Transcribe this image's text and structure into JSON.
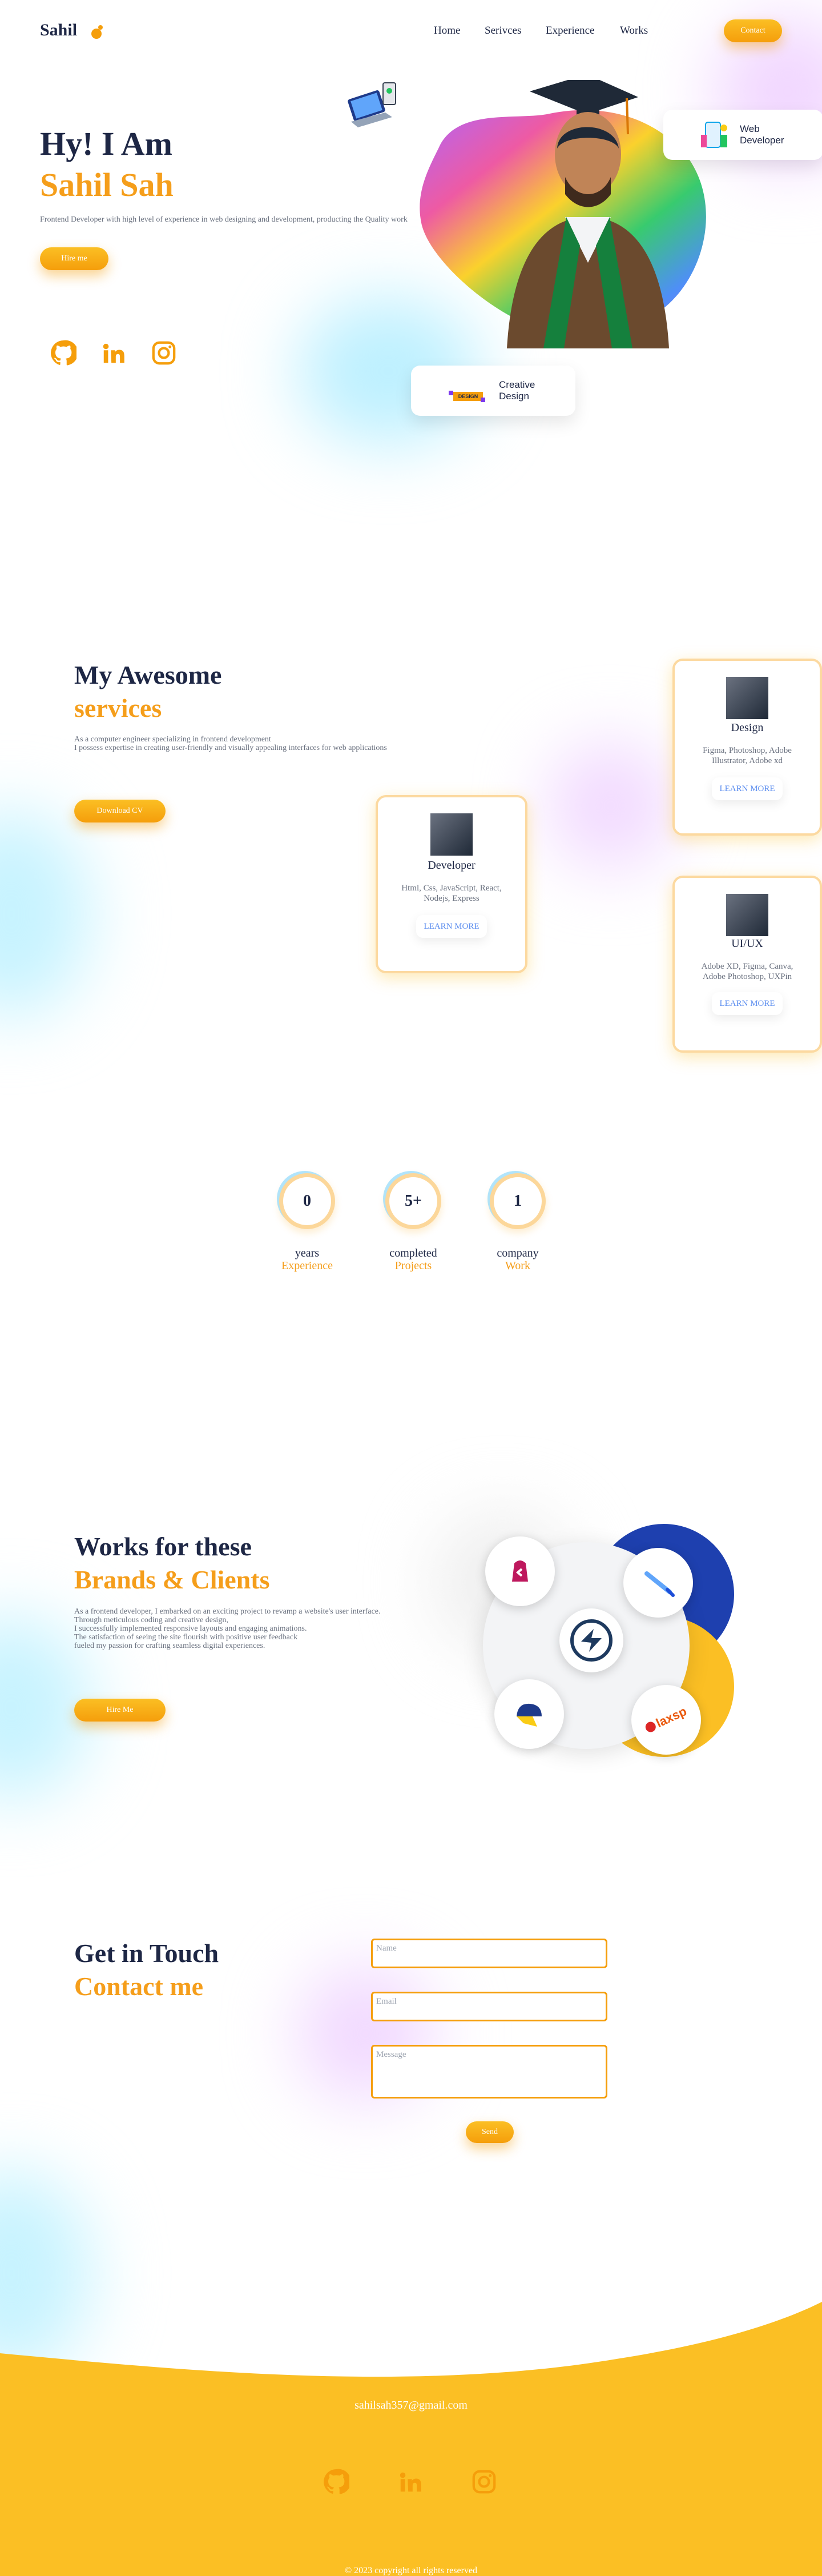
{
  "header": {
    "logo": "Sahil",
    "nav": [
      "Home",
      "Serivces",
      "Experience",
      "Works"
    ],
    "contact_label": "Contact"
  },
  "hero": {
    "greeting": "Hy! I Am",
    "name": "Sahil Sah",
    "tagline": "Frontend Developer with high level of experience in web designing and development, producting the Quality work",
    "hire_label": "Hire me",
    "card_web": "Web\nDeveloper",
    "card_creative": "Creative\nDesign",
    "badge_text": "DESIGN"
  },
  "social_icons": [
    "github-icon",
    "linkedin-icon",
    "instagram-icon"
  ],
  "services": {
    "title_line1": "My Awesome",
    "title_line2": "services",
    "desc_line1": "As a computer engineer specializing in frontend development",
    "desc_line2": "I possess expertise in creating user-friendly and visually appealing interfaces for web applications",
    "download_label": "Download CV",
    "cards": [
      {
        "title": "Design",
        "desc": "Figma, Photoshop, Adobe Illustrator, Adobe xd",
        "link": "LEARN MORE"
      },
      {
        "title": "Developer",
        "desc": "Html, Css, JavaScript, React, Nodejs, Express",
        "link": "LEARN MORE"
      },
      {
        "title": "UI/UX",
        "desc": "Adobe XD, Figma, Canva, Adobe Photoshop, UXPin",
        "link": "LEARN MORE"
      }
    ]
  },
  "stats": [
    {
      "value": "0",
      "label1": "years",
      "label2": "Experience"
    },
    {
      "value": "5+",
      "label1": "completed",
      "label2": "Projects"
    },
    {
      "value": "1",
      "label1": "company",
      "label2": "Work"
    }
  ],
  "works": {
    "title_line1": "Works for these",
    "title_line2": "Brands & Clients",
    "lines": [
      "As a frontend developer, I embarked on an exciting project to revamp a website's user interface.",
      "Through meticulous coding and creative design,",
      "I successfully implemented responsive layouts and engaging animations.",
      "The satisfaction of seeing the site flourish with positive user feedback",
      "fueled my passion for crafting seamless digital experiences."
    ],
    "hire_label": "Hire Me",
    "brand_logo_text": "laxsp"
  },
  "contact": {
    "title_line1": "Get in Touch",
    "title_line2": "Contact me",
    "name_placeholder": "Name",
    "email_placeholder": "Email",
    "message_placeholder": "Message",
    "send_label": "Send"
  },
  "footer": {
    "email": "sahilsah357@gmail.com",
    "copyright": "© 2023 copyright all rights reserved"
  },
  "colors": {
    "accent": "#f59e0b",
    "navy": "#1e2745",
    "footer": "#fbbf24"
  }
}
